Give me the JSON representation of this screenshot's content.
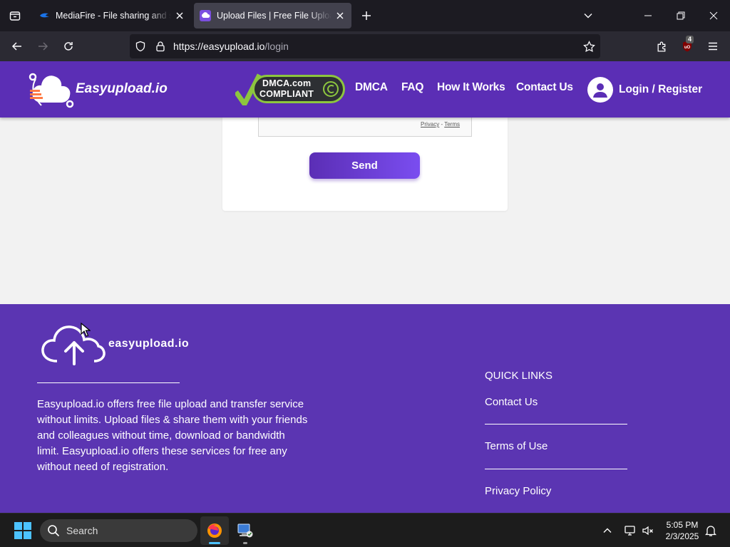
{
  "browser": {
    "tabs": [
      {
        "title": "MediaFire - File sharing and storage made simple",
        "favicon": "mediafire-icon",
        "active": false
      },
      {
        "title": "Upload Files | Free File Upload and Transfer",
        "favicon": "easyupload-icon",
        "active": true
      }
    ],
    "url": {
      "host": "https://easyupload.io",
      "path": "/login"
    },
    "extension_badge": "4"
  },
  "site": {
    "brand": "Easyupload.io",
    "dmca": {
      "line1": "DMCA.com",
      "line2": "COMPLIANT"
    },
    "nav": [
      "DMCA",
      "FAQ",
      "How It Works",
      "Contact Us"
    ],
    "login_label": "Login / Register",
    "recaptcha_links": {
      "privacy": "Privacy",
      "sep": " - ",
      "terms": "Terms"
    },
    "send_label": "Send",
    "footer": {
      "logo_text": "easyupload.io",
      "description": "Easyupload.io offers free file upload and transfer service without limits. Upload files & share them with your friends and colleagues without time, download or bandwidth limit. Easyupload.io offers these services for free any without need of registration.",
      "quick_links_title": "QUICK LINKS",
      "quick_links": [
        "Contact Us",
        "Terms of Use",
        "Privacy Policy"
      ]
    },
    "colors": {
      "brand_purple": "#5b2eb5",
      "footer_purple": "#5b35b2",
      "button_gradient_end": "#7a4df0"
    }
  },
  "taskbar": {
    "search_placeholder": "Search",
    "time": "5:05 PM",
    "date": "2/3/2025",
    "pinned": [
      "firefox-icon",
      "network-computer-icon"
    ]
  }
}
